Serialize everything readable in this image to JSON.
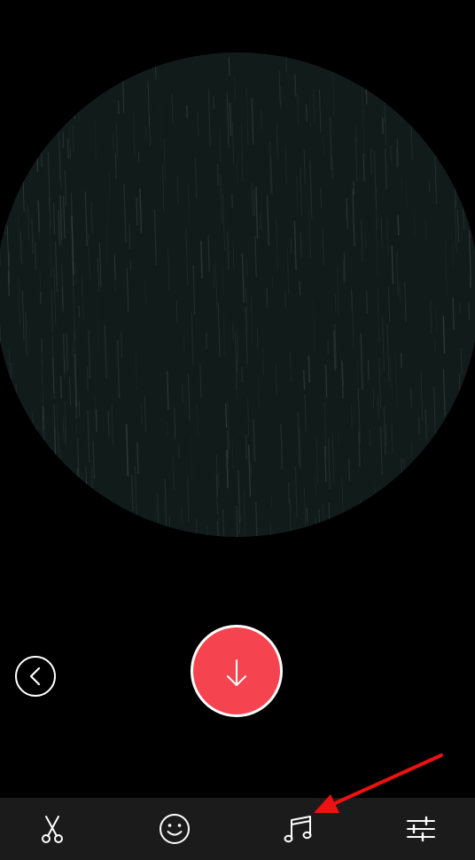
{
  "colors": {
    "background": "#000000",
    "preview_fill": "#111b1a",
    "accent": "#f5444f",
    "toolbar_bg": "#1b1b1b",
    "icon": "#ffffff",
    "annotation": "#ee1111"
  },
  "preview": {
    "texture": "rain-streaks"
  },
  "controls": {
    "back_icon": "chevron-left-icon",
    "download_icon": "arrow-down-icon"
  },
  "toolbar": {
    "tools": [
      {
        "id": "trim",
        "icon": "scissors-icon"
      },
      {
        "id": "sticker",
        "icon": "smiley-icon"
      },
      {
        "id": "music",
        "icon": "music-note-icon"
      },
      {
        "id": "adjust",
        "icon": "sliders-icon"
      }
    ]
  },
  "annotation": {
    "icon": "red-arrow-icon",
    "target": "music"
  }
}
